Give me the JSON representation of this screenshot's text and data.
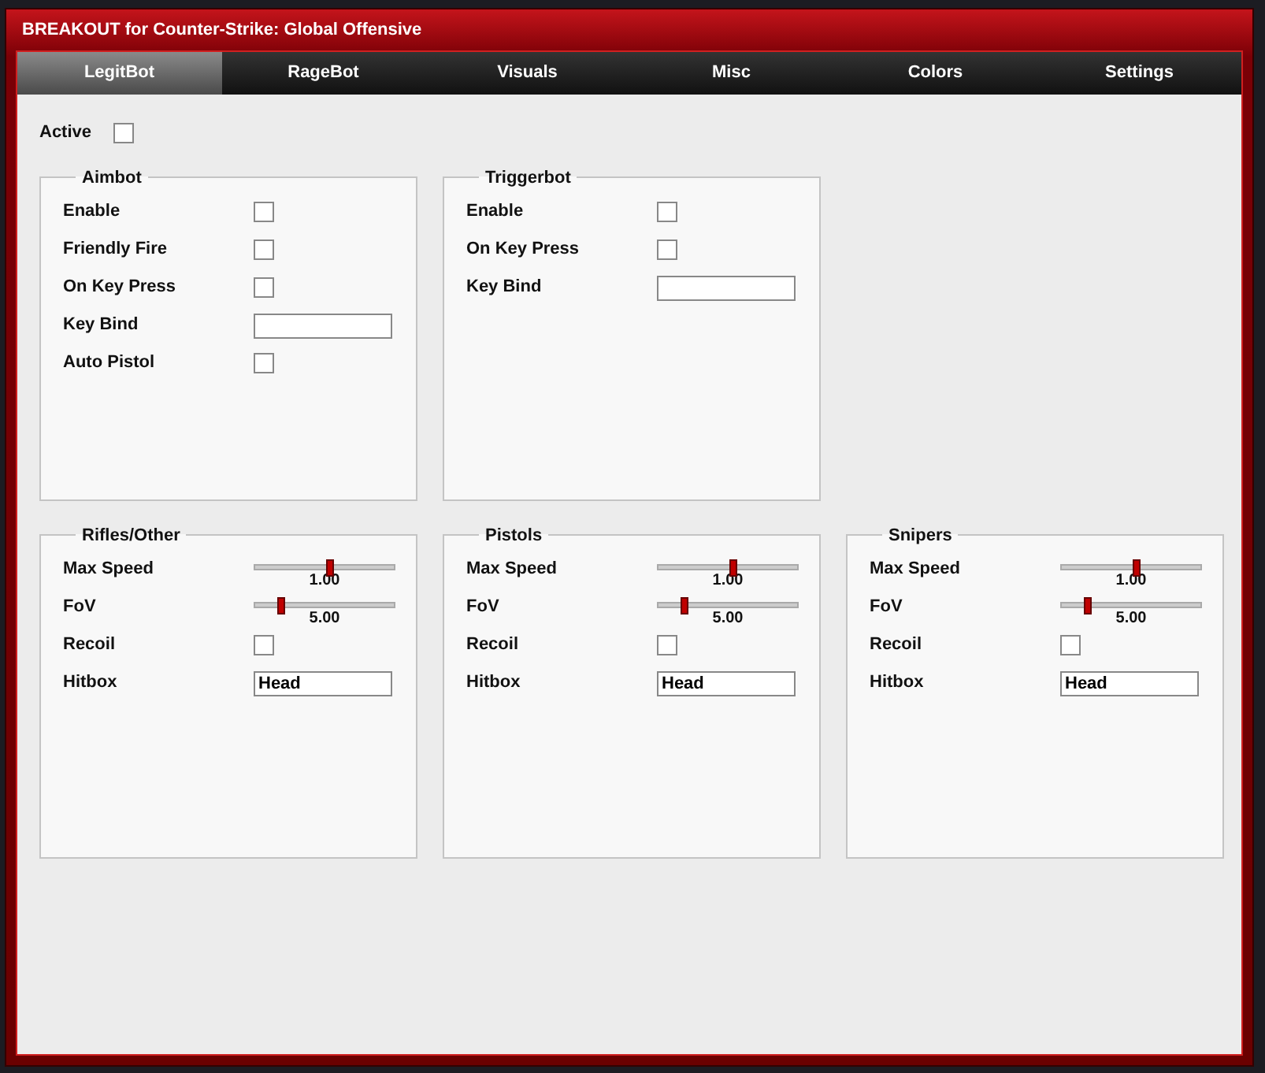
{
  "window": {
    "title": "BREAKOUT for Counter-Strike: Global Offensive"
  },
  "tabs": [
    {
      "label": "LegitBot",
      "selected": true
    },
    {
      "label": "RageBot",
      "selected": false
    },
    {
      "label": "Visuals",
      "selected": false
    },
    {
      "label": "Misc",
      "selected": false
    },
    {
      "label": "Colors",
      "selected": false
    },
    {
      "label": "Settings",
      "selected": false
    }
  ],
  "active": {
    "label": "Active",
    "checked": false
  },
  "group_rows": [
    {
      "groups": [
        {
          "title": "Aimbot",
          "rows": [
            {
              "kind": "checkbox",
              "label": "Enable",
              "checked": false
            },
            {
              "kind": "checkbox",
              "label": "Friendly Fire",
              "checked": false
            },
            {
              "kind": "checkbox",
              "label": "On Key Press",
              "checked": false
            },
            {
              "kind": "field",
              "label": "Key Bind"
            },
            {
              "kind": "checkbox",
              "label": "Auto Pistol",
              "checked": false
            }
          ]
        },
        {
          "title": "Triggerbot",
          "rows": [
            {
              "kind": "checkbox",
              "label": "Enable",
              "checked": false
            },
            {
              "kind": "checkbox",
              "label": "On Key Press",
              "checked": false
            },
            {
              "kind": "field",
              "label": "Key Bind"
            }
          ]
        }
      ]
    },
    {
      "groups": [
        {
          "title": "Rifles/Other",
          "rows": [
            {
              "kind": "slider",
              "label": "Max Speed",
              "level": 0.53,
              "reading": "1.00"
            },
            {
              "kind": "slider",
              "label": "FoV",
              "level": 0.18,
              "reading": "5.00"
            },
            {
              "kind": "checkbox",
              "label": "Recoil",
              "checked": false
            },
            {
              "kind": "field",
              "label": "Hitbox",
              "value": "Head"
            }
          ]
        },
        {
          "title": "Pistols",
          "rows": [
            {
              "kind": "slider",
              "label": "Max Speed",
              "level": 0.53,
              "reading": "1.00"
            },
            {
              "kind": "slider",
              "label": "FoV",
              "level": 0.18,
              "reading": "5.00"
            },
            {
              "kind": "checkbox",
              "label": "Recoil",
              "checked": false
            },
            {
              "kind": "field",
              "label": "Hitbox",
              "value": "Head"
            }
          ]
        },
        {
          "title": "Snipers",
          "rows": [
            {
              "kind": "slider",
              "label": "Max Speed",
              "level": 0.53,
              "reading": "1.00"
            },
            {
              "kind": "slider",
              "label": "FoV",
              "level": 0.18,
              "reading": "5.00"
            },
            {
              "kind": "checkbox",
              "label": "Recoil",
              "checked": false
            },
            {
              "kind": "field",
              "label": "Hitbox",
              "value": "Head"
            }
          ]
        }
      ]
    }
  ]
}
